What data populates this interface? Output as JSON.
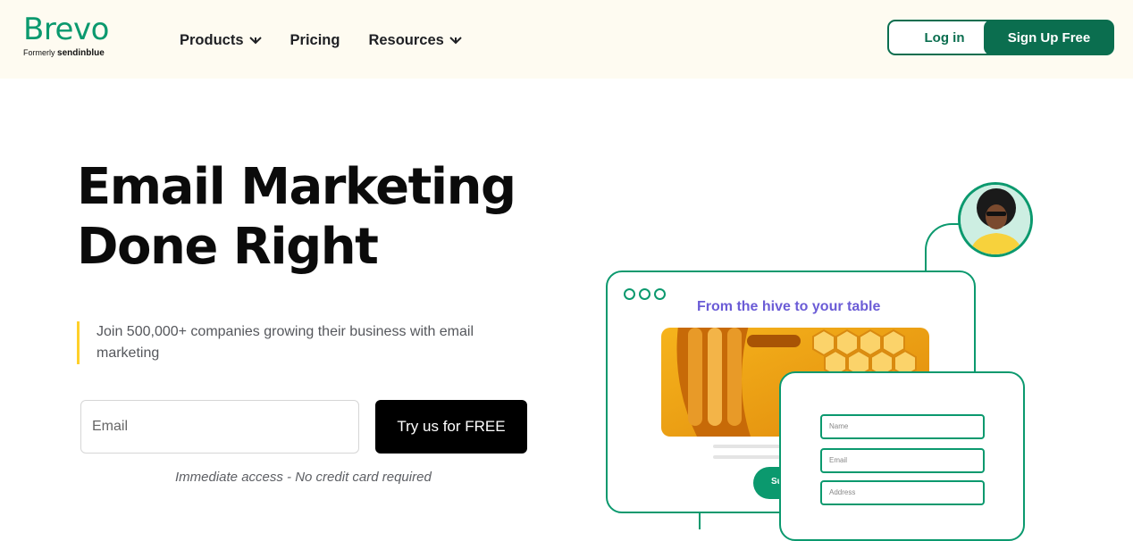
{
  "brand": {
    "name": "Brevo",
    "formerly_prefix": "Formerly",
    "formerly_name": "sendinblue",
    "color": "#0b996e"
  },
  "nav": {
    "items": [
      {
        "label": "Products",
        "has_dropdown": true
      },
      {
        "label": "Pricing",
        "has_dropdown": false
      },
      {
        "label": "Resources",
        "has_dropdown": true
      }
    ]
  },
  "header_actions": {
    "login_label": "Log in",
    "signup_label": "Sign Up Free"
  },
  "hero": {
    "title_line1": "Email Marketing",
    "title_line2": "Done Right",
    "subtitle": "Join 500,000+ companies growing their business with email marketing",
    "email_placeholder": "Email",
    "cta_label": "Try us for FREE",
    "note": "Immediate access - No credit card required"
  },
  "illustration": {
    "card_title": "From the hive to your table",
    "subscribe_label": "Su",
    "form_fields": [
      "Name",
      "Email",
      "Address"
    ]
  },
  "colors": {
    "header_bg": "#fefbf1",
    "primary_dark": "#0b6e4f",
    "accent_yellow": "#ffd02a",
    "card_title": "#6b5cd6"
  }
}
